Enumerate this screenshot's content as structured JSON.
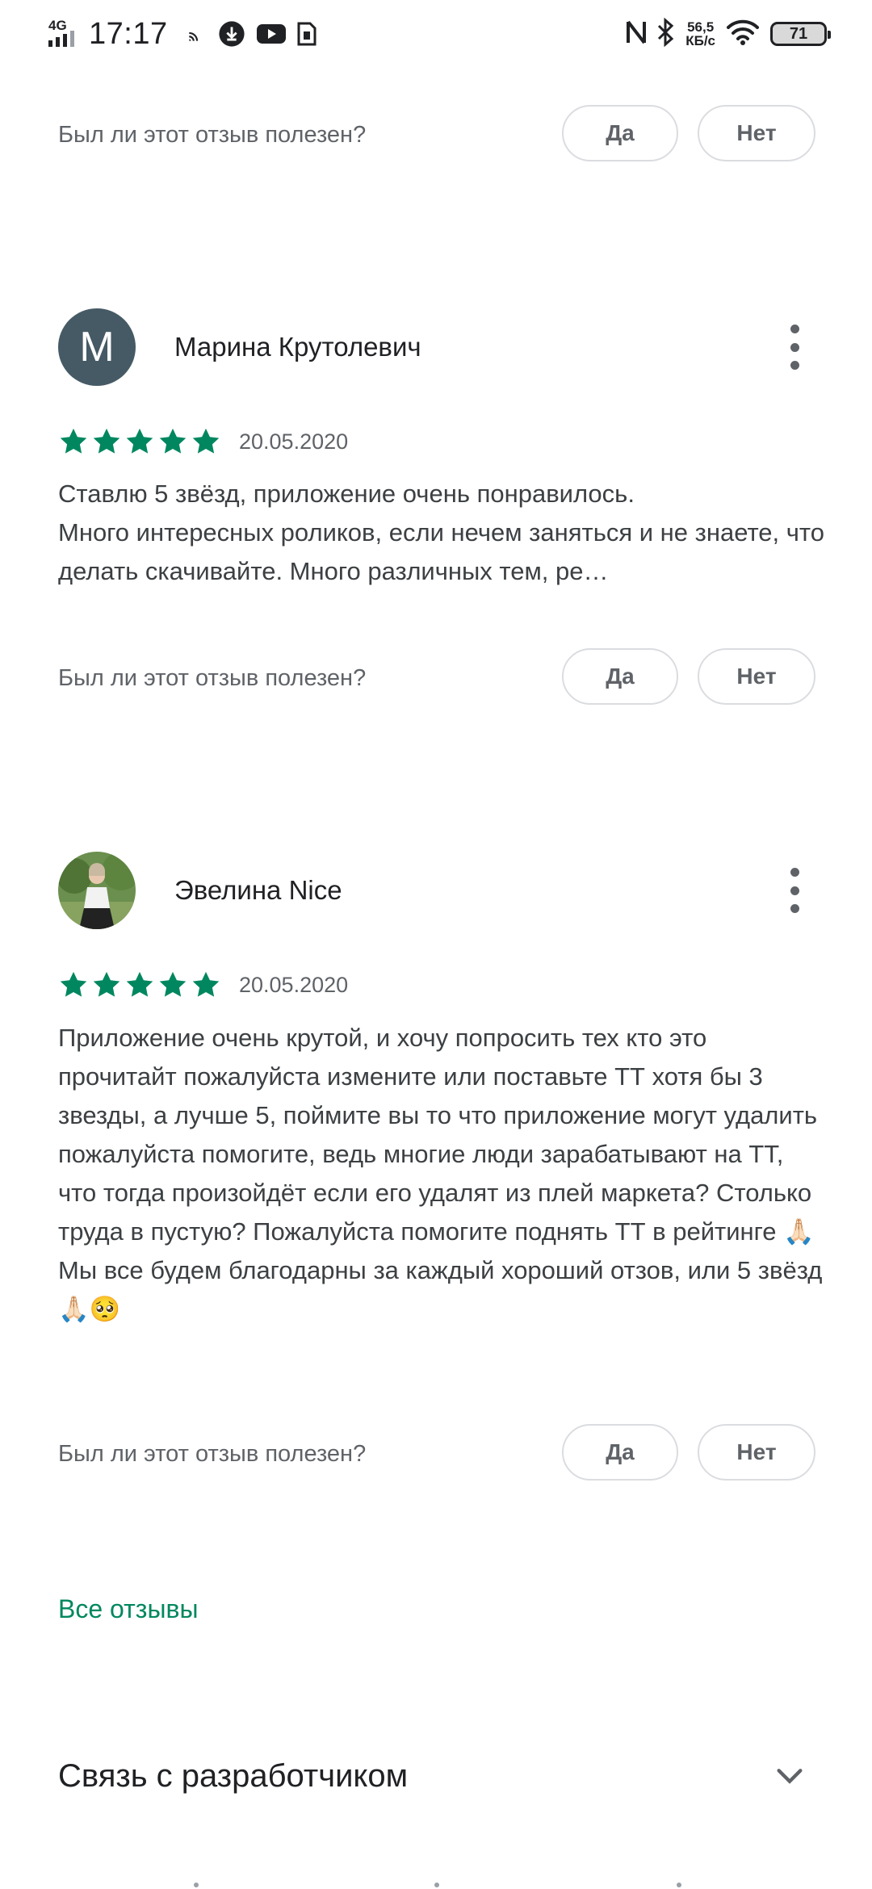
{
  "status_bar": {
    "network": "4G",
    "time": "17:17",
    "speed_value": "56,5",
    "speed_unit": "КБ/с",
    "battery": "71",
    "left_icons": [
      "cast-icon",
      "download-icon",
      "youtube-icon",
      "sim-icon"
    ],
    "right_icons": [
      "nfc-icon",
      "bluetooth-icon",
      "wifi-icon",
      "battery-icon"
    ]
  },
  "helpful_prompt": "Был ли этот отзыв полезен?",
  "yes_label": "Да",
  "no_label": "Нет",
  "reviews": [
    {
      "author": "Марина Крутолевич",
      "avatar_letter": "M",
      "rating": 5,
      "date": "20.05.2020",
      "text": "Ставлю 5 звёзд, приложение очень понравилось.\nМного интересных роликов, если нечем заняться и не знаете, что делать скачивайте. Много различных тем, ре…"
    },
    {
      "author": "Эвелина Nice",
      "avatar_letter": "",
      "rating": 5,
      "date": "20.05.2020",
      "text": "Приложение очень крутой, и хочу попросить тех кто это прочитайт пожалуйста измените или поставьте ТТ хотя бы 3 звезды, а лучше 5, поймите вы то что приложение могут удалить пожалуйста помогите, ведь многие люди зарабатывают на ТТ, что тогда произойдёт если его удалят из плей маркета? Столько труда в пустую? Пожалуйста помогите поднять ТТ в рейтинге 🙏🏻 Мы все будем благодарны за каждый хороший отзов, или 5 звёзд 🙏🏻🥺"
    }
  ],
  "all_reviews_link": "Все отзывы",
  "developer_contact": "Связь с разработчиком",
  "colors": {
    "accent_green": "#01875f",
    "avatar_bg": "#455a64",
    "star": "#01875f"
  }
}
